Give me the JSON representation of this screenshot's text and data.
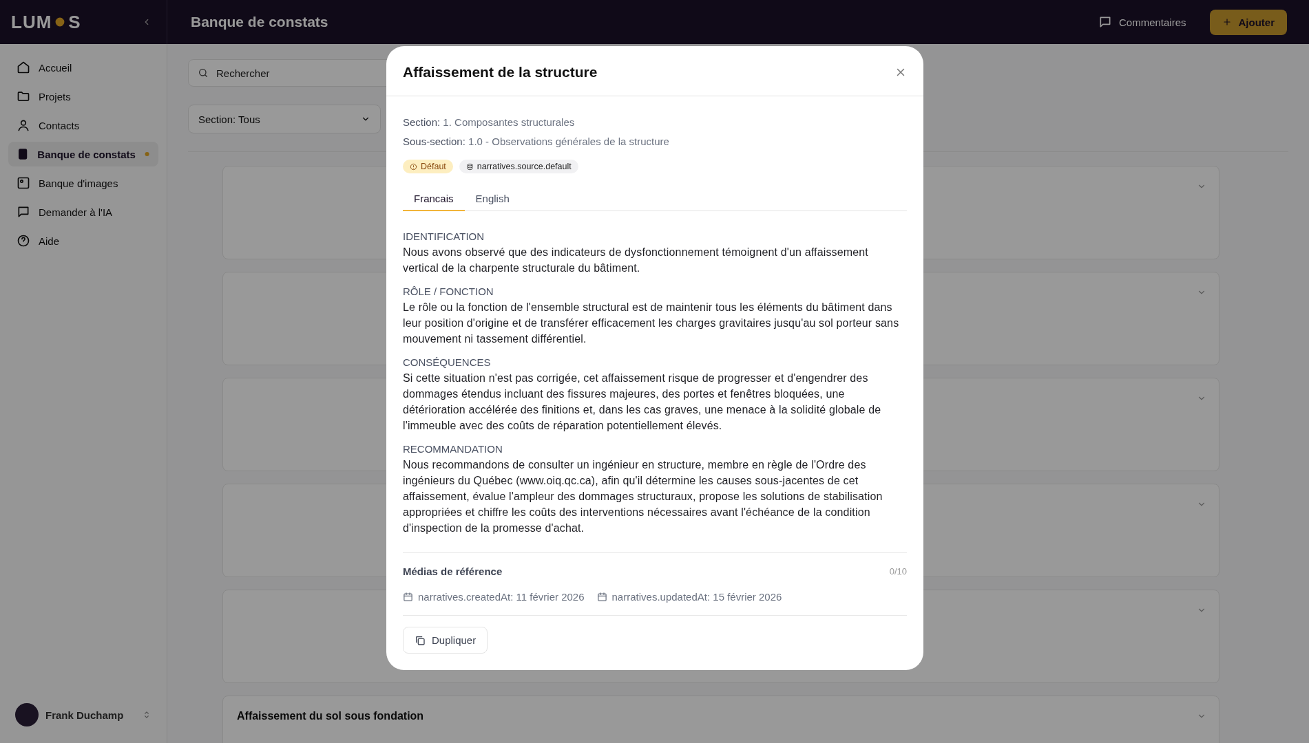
{
  "header": {
    "logo_start": "LUM",
    "logo_end": "S",
    "page_title": "Banque de constats",
    "comments_button": "Commentaires",
    "add_button": "Ajouter"
  },
  "sidebar": {
    "items": [
      {
        "label": "Accueil",
        "selected": false
      },
      {
        "label": "Projets",
        "selected": false
      },
      {
        "label": "Contacts",
        "selected": false
      },
      {
        "label": "Banque de constats",
        "selected": true
      },
      {
        "label": "Banque d'images",
        "selected": false
      },
      {
        "label": "Demander à l'IA",
        "selected": false
      },
      {
        "label": "Aide",
        "selected": false
      }
    ],
    "user": {
      "name": "Frank Duchamp"
    }
  },
  "toolbar": {
    "search": {
      "placeholder": "Rechercher"
    },
    "section_filter": "Section: Tous"
  },
  "cards": [
    {
      "title": "Affaissement du sol sous fondation"
    }
  ],
  "modal": {
    "title": "Affaissement de la structure",
    "meta": [
      {
        "label": "Section:",
        "value": "1. Composantes structurales"
      },
      {
        "label": "Sous-section:",
        "value": "1.0 - Observations générales de la structure"
      }
    ],
    "badges": [
      {
        "kind": "warning",
        "label": "Défaut"
      },
      {
        "kind": "source",
        "label": "narratives.source.default"
      }
    ],
    "tabs": [
      {
        "label": "Francais",
        "selected": true
      },
      {
        "label": "English",
        "selected": false
      }
    ],
    "sections": [
      {
        "heading": "IDENTIFICATION",
        "text": "Nous avons observé que des indicateurs de dysfonctionnement témoignent d'un affaissement vertical de la charpente structurale du bâtiment."
      },
      {
        "heading": "RÔLE / FONCTION",
        "text": "Le rôle ou la fonction de l'ensemble structural est de maintenir tous les éléments du bâtiment dans leur position d'origine et de transférer efficacement les charges gravitaires jusqu'au sol porteur sans mouvement ni tassement différentiel."
      },
      {
        "heading": "CONSÉQUENCES",
        "text": "Si cette situation n'est pas corrigée, cet affaissement risque de progresser et d'engendrer des dommages étendus incluant des fissures majeures, des portes et fenêtres bloquées, une détérioration accélérée des finitions et, dans les cas graves, une menace à la solidité globale de l'immeuble avec des coûts de réparation potentiellement élevés."
      },
      {
        "heading": "RECOMMANDATION",
        "text": "Nous recommandons de consulter un ingénieur en structure, membre en règle de l'Ordre des ingénieurs du Québec (www.oiq.qc.ca), afin qu'il détermine les causes sous-jacentes de cet affaissement, évalue l'ampleur des dommages structuraux, propose les solutions de stabilisation appropriées et chiffre les coûts des interventions nécessaires avant l'échéance de la condition d'inspection de la promesse d'achat."
      }
    ],
    "media": {
      "heading": "Médias de référence",
      "count": "0/10"
    },
    "dates": [
      "narratives.createdAt: 11 février 2026",
      "narratives.updatedAt: 15 février 2026"
    ],
    "duplicate_button": "Dupliquer"
  }
}
